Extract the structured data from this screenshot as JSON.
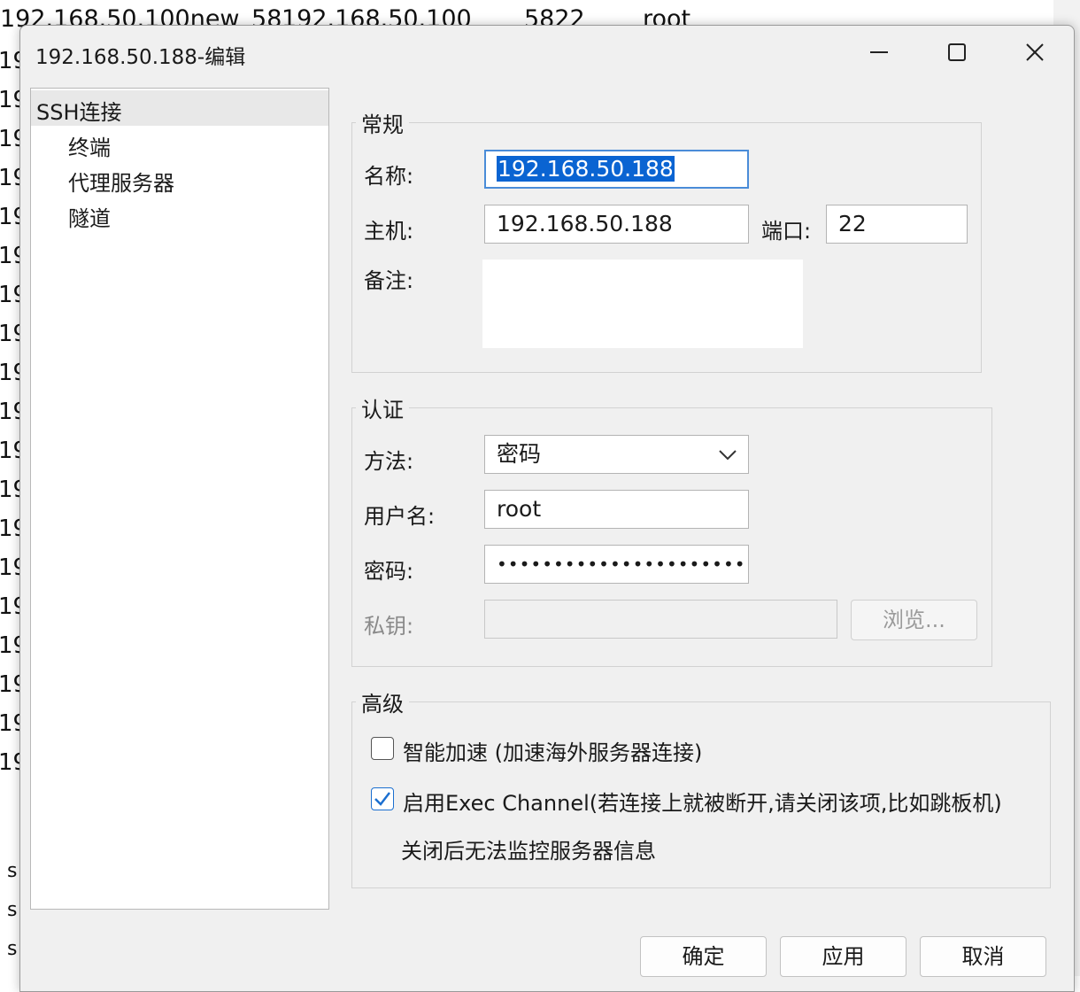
{
  "background": {
    "header_row": [
      "192.168.50.100new_58",
      "192.168.50.100",
      "5822",
      "root"
    ],
    "row_prefix": "19",
    "side_letter": "s"
  },
  "dialog": {
    "title": "192.168.50.188-编辑",
    "tree": {
      "root": "SSH连接",
      "children": [
        "终端",
        "代理服务器",
        "隧道"
      ]
    },
    "general": {
      "legend": "常规",
      "name_label": "名称:",
      "name_value": "192.168.50.188",
      "host_label": "主机:",
      "host_value": "192.168.50.188",
      "port_label": "端口:",
      "port_value": "22",
      "note_label": "备注:",
      "note_value": ""
    },
    "auth": {
      "legend": "认证",
      "method_label": "方法:",
      "method_value": "密码",
      "user_label": "用户名:",
      "user_value": "root",
      "password_label": "密码:",
      "password_value": "••••••••••••••••••••••",
      "key_label": "私钥:",
      "key_value": "",
      "browse_label": "浏览..."
    },
    "advanced": {
      "legend": "高级",
      "accel_label": "智能加速 (加速海外服务器连接)",
      "accel_checked": false,
      "exec_label": "启用Exec Channel(若连接上就被断开,请关闭该项,比如跳板机)",
      "exec_checked": true,
      "exec_note": "关闭后无法监控服务器信息"
    },
    "buttons": {
      "ok": "确定",
      "apply": "应用",
      "cancel": "取消"
    },
    "accent_color": "#0a64d2"
  }
}
